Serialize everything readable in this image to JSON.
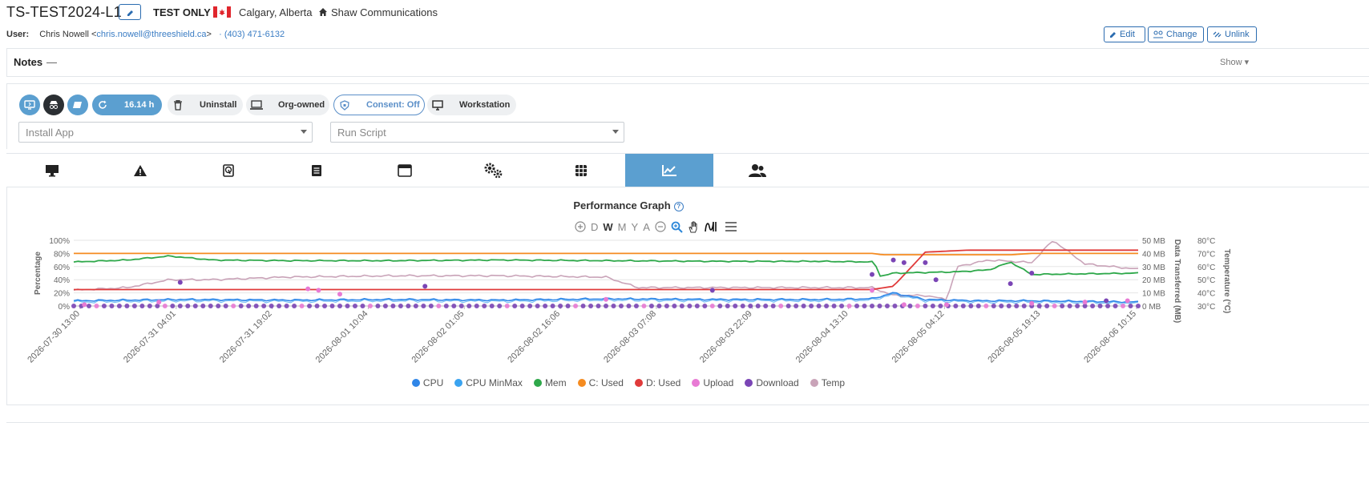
{
  "device": {
    "name": "TS-TEST2024-L1",
    "badge": "TEST ONLY",
    "location": "Calgary, Alberta",
    "isp": "Shaw Communications"
  },
  "user": {
    "label": "User:",
    "name": "Chris Nowell",
    "email": "chris.nowell@threeshield.ca",
    "phone": "· (403) 471-6132"
  },
  "header_buttons": {
    "edit": "Edit",
    "change": "Change",
    "unlink": "Unlink"
  },
  "notes": {
    "label": "Notes",
    "collapse": "—",
    "show": "Show ▾"
  },
  "actions": {
    "uptime": "16.14 h",
    "uninstall": "Uninstall",
    "ownership": "Org-owned",
    "consent": "Consent: Off",
    "type": "Workstation",
    "install_placeholder": "Install App",
    "script_placeholder": "Run Script"
  },
  "tabs": [
    "monitor-icon",
    "warning-icon",
    "disk-icon",
    "document-icon",
    "window-icon",
    "settings-icon",
    "apps-icon",
    "chart-icon",
    "users-icon"
  ],
  "active_tab": 7,
  "graph": {
    "title": "Performance Graph",
    "help": "?",
    "zoom_letters": [
      "D",
      "W",
      "M",
      "Y",
      "A"
    ]
  },
  "colors": {
    "cpu": "#2f86e8",
    "cpu_minmax": "#3aa3f0",
    "mem": "#2ea84a",
    "c_used": "#f58b20",
    "d_used": "#e03a3a",
    "upload": "#e87ad4",
    "download": "#7a45b5",
    "temp": "#c9a3b8",
    "accent": "#5b9fd0",
    "link": "#3b7dc4"
  },
  "chart_data": {
    "type": "line",
    "title": "Performance Graph",
    "x_ticks": [
      "2026-07-30 13:00",
      "2026-07-31 04:01",
      "2026-07-31 19:02",
      "2026-08-01 10:04",
      "2026-08-02 01:05",
      "2026-08-02 16:06",
      "2026-08-03 07:08",
      "2026-08-03 22:09",
      "2026-08-04 13:10",
      "2026-08-05 04:12",
      "2026-08-05 19:13",
      "2026-08-06 10:15"
    ],
    "y_left": {
      "label": "Percentage",
      "ticks": [
        "100%",
        "80%",
        "60%",
        "40%",
        "20%",
        "0%"
      ],
      "range": [
        0,
        100
      ]
    },
    "y_right1": {
      "label": "Data Transferred (MB)",
      "ticks": [
        "50 MB",
        "40 MB",
        "30 MB",
        "20 MB",
        "10 MB",
        "0 MB"
      ],
      "range": [
        0,
        50
      ]
    },
    "y_right2": {
      "label": "Temperature (°C)",
      "ticks": [
        "80°C",
        "70°C",
        "60°C",
        "50°C",
        "40°C",
        "30°C"
      ],
      "range": [
        30,
        80
      ]
    },
    "legend": [
      "CPU",
      "CPU MinMax",
      "Mem",
      "C: Used",
      "D: Used",
      "Upload",
      "Download",
      "Temp"
    ],
    "series": [
      {
        "name": "CPU",
        "unit": "%",
        "anchors": [
          [
            0,
            8
          ],
          [
            0.1,
            10
          ],
          [
            0.2,
            9
          ],
          [
            0.3,
            10
          ],
          [
            0.4,
            9
          ],
          [
            0.5,
            11
          ],
          [
            0.6,
            10
          ],
          [
            0.7,
            10
          ],
          [
            0.75,
            11
          ],
          [
            0.77,
            20
          ],
          [
            0.8,
            10
          ],
          [
            0.85,
            8
          ],
          [
            0.9,
            8
          ],
          [
            1,
            6
          ]
        ]
      },
      {
        "name": "Mem",
        "unit": "%",
        "anchors": [
          [
            0,
            67
          ],
          [
            0.05,
            70
          ],
          [
            0.09,
            76
          ],
          [
            0.13,
            70
          ],
          [
            0.2,
            69
          ],
          [
            0.3,
            69
          ],
          [
            0.4,
            70
          ],
          [
            0.5,
            69
          ],
          [
            0.6,
            68
          ],
          [
            0.7,
            68
          ],
          [
            0.752,
            67
          ],
          [
            0.758,
            45
          ],
          [
            0.77,
            50
          ],
          [
            0.83,
            52
          ],
          [
            0.86,
            55
          ],
          [
            0.88,
            67
          ],
          [
            0.9,
            48
          ],
          [
            1,
            50
          ]
        ]
      },
      {
        "name": "C: Used",
        "unit": "%",
        "anchors": [
          [
            0,
            80
          ],
          [
            0.75,
            80
          ],
          [
            0.76,
            78
          ],
          [
            0.88,
            78
          ],
          [
            0.9,
            80
          ],
          [
            1,
            80
          ]
        ]
      },
      {
        "name": "D: Used",
        "unit": "%",
        "anchors": [
          [
            0,
            25
          ],
          [
            0.75,
            25
          ],
          [
            0.77,
            30
          ],
          [
            0.8,
            82
          ],
          [
            0.84,
            85
          ],
          [
            1,
            85
          ]
        ]
      },
      {
        "name": "Temp",
        "unit": "°C",
        "anchors": [
          [
            0,
            42
          ],
          [
            0.05,
            44
          ],
          [
            0.09,
            50
          ],
          [
            0.13,
            50
          ],
          [
            0.2,
            52
          ],
          [
            0.3,
            53
          ],
          [
            0.4,
            53
          ],
          [
            0.5,
            52
          ],
          [
            0.53,
            44
          ],
          [
            0.7,
            44
          ],
          [
            0.75,
            44
          ],
          [
            0.77,
            38
          ],
          [
            0.8,
            38
          ],
          [
            0.82,
            35
          ],
          [
            0.83,
            60
          ],
          [
            0.86,
            65
          ],
          [
            0.9,
            63
          ],
          [
            0.92,
            80
          ],
          [
            0.95,
            62
          ],
          [
            1,
            58
          ]
        ]
      }
    ],
    "upload_points_mb": [
      [
        0.01,
        1
      ],
      [
        0.08,
        3
      ],
      [
        0.22,
        13
      ],
      [
        0.23,
        12
      ],
      [
        0.25,
        9
      ],
      [
        0.5,
        5
      ],
      [
        0.75,
        12
      ],
      [
        0.78,
        1
      ],
      [
        0.82,
        1
      ],
      [
        0.9,
        2
      ],
      [
        0.95,
        3
      ],
      [
        0.99,
        4
      ]
    ],
    "download_points_mb": [
      [
        0.1,
        18
      ],
      [
        0.33,
        15
      ],
      [
        0.6,
        12
      ],
      [
        0.75,
        24
      ],
      [
        0.77,
        35
      ],
      [
        0.78,
        33
      ],
      [
        0.8,
        33
      ],
      [
        0.81,
        20
      ],
      [
        0.88,
        17
      ],
      [
        0.9,
        25
      ],
      [
        0.97,
        4
      ]
    ]
  }
}
